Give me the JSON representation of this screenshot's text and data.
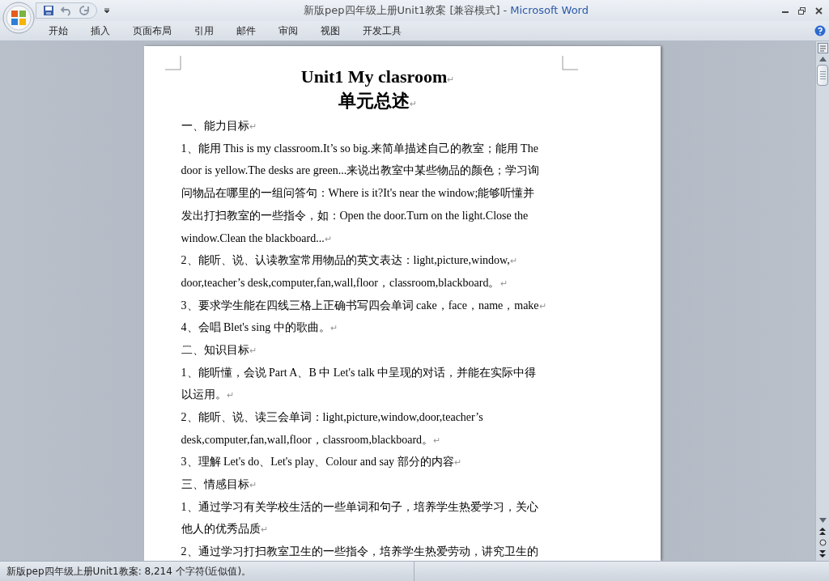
{
  "window": {
    "title": "新版pep四年级上册Unit1教案 [兼容模式]",
    "separator": "-",
    "app": "Microsoft Word"
  },
  "tabs": [
    {
      "label": "开始",
      "selected": false
    },
    {
      "label": "插入",
      "selected": false
    },
    {
      "label": "页面布局",
      "selected": false
    },
    {
      "label": "引用",
      "selected": false
    },
    {
      "label": "邮件",
      "selected": false
    },
    {
      "label": "审阅",
      "selected": false
    },
    {
      "label": "视图",
      "selected": false
    },
    {
      "label": "开发工具",
      "selected": false
    }
  ],
  "document": {
    "title": "Unit1 My clasroom",
    "subtitle": "单元总述",
    "mark": "↵",
    "paragraphs": [
      {
        "lines": [
          "一、能力目标"
        ],
        "marked": true
      },
      {
        "lines": [
          "1、能用 This is my classroom.It’s so big.来简单描述自己的教室；能用 The",
          "door is yellow.The desks are green...来说出教室中某些物品的颜色；学习询",
          "问物品在哪里的一组问答句：Where is it?It's near the window;能够听懂并",
          "发出打扫教室的一些指令，如：Open the door.Turn on the light.Close the",
          "window.Clean the blackboard..."
        ],
        "marked": true
      },
      {
        "lines": [
          "2、能听、说、认读教室常用物品的英文表达：light,picture,window,"
        ],
        "marked": true
      },
      {
        "lines": [
          "door,teacher’s desk,computer,fan,wall,floor，classroom,blackboard。"
        ],
        "marked": true
      },
      {
        "lines": [
          "3、要求学生能在四线三格上正确书写四会单词 cake，face，name，make"
        ],
        "marked": true
      },
      {
        "lines": [
          "4、会唱 Blet's sing  中的歌曲。"
        ],
        "marked": true
      },
      {
        "lines": [
          "二、知识目标"
        ],
        "marked": true
      },
      {
        "lines": [
          "1、能听懂，会说 Part A、B 中 Let's talk 中呈现的对话，并能在实际中得",
          "以运用。"
        ],
        "marked": true
      },
      {
        "lines": [
          "2、能听、说、读三会单词：light,picture,window,door,teacher’s",
          "desk,computer,fan,wall,floor，classroom,blackboard。"
        ],
        "marked": true
      },
      {
        "lines": [
          "3、理解 Let's do、Let's play、Colour and say 部分的内容"
        ],
        "marked": true
      },
      {
        "lines": [
          "三、情感目标"
        ],
        "marked": true
      },
      {
        "lines": [
          "1、通过学习有关学校生活的一些单词和句子，培养学生热爱学习，关心",
          "他人的优秀品质"
        ],
        "marked": true
      },
      {
        "lines": [
          "2、通过学习打扫教室卫生的一些指令，培养学生热爱劳动，讲究卫生的"
        ],
        "marked": false
      }
    ]
  },
  "status_bar": {
    "text": "新版pep四年级上册Unit1教案: 8,214 个字符(近似值)。"
  }
}
